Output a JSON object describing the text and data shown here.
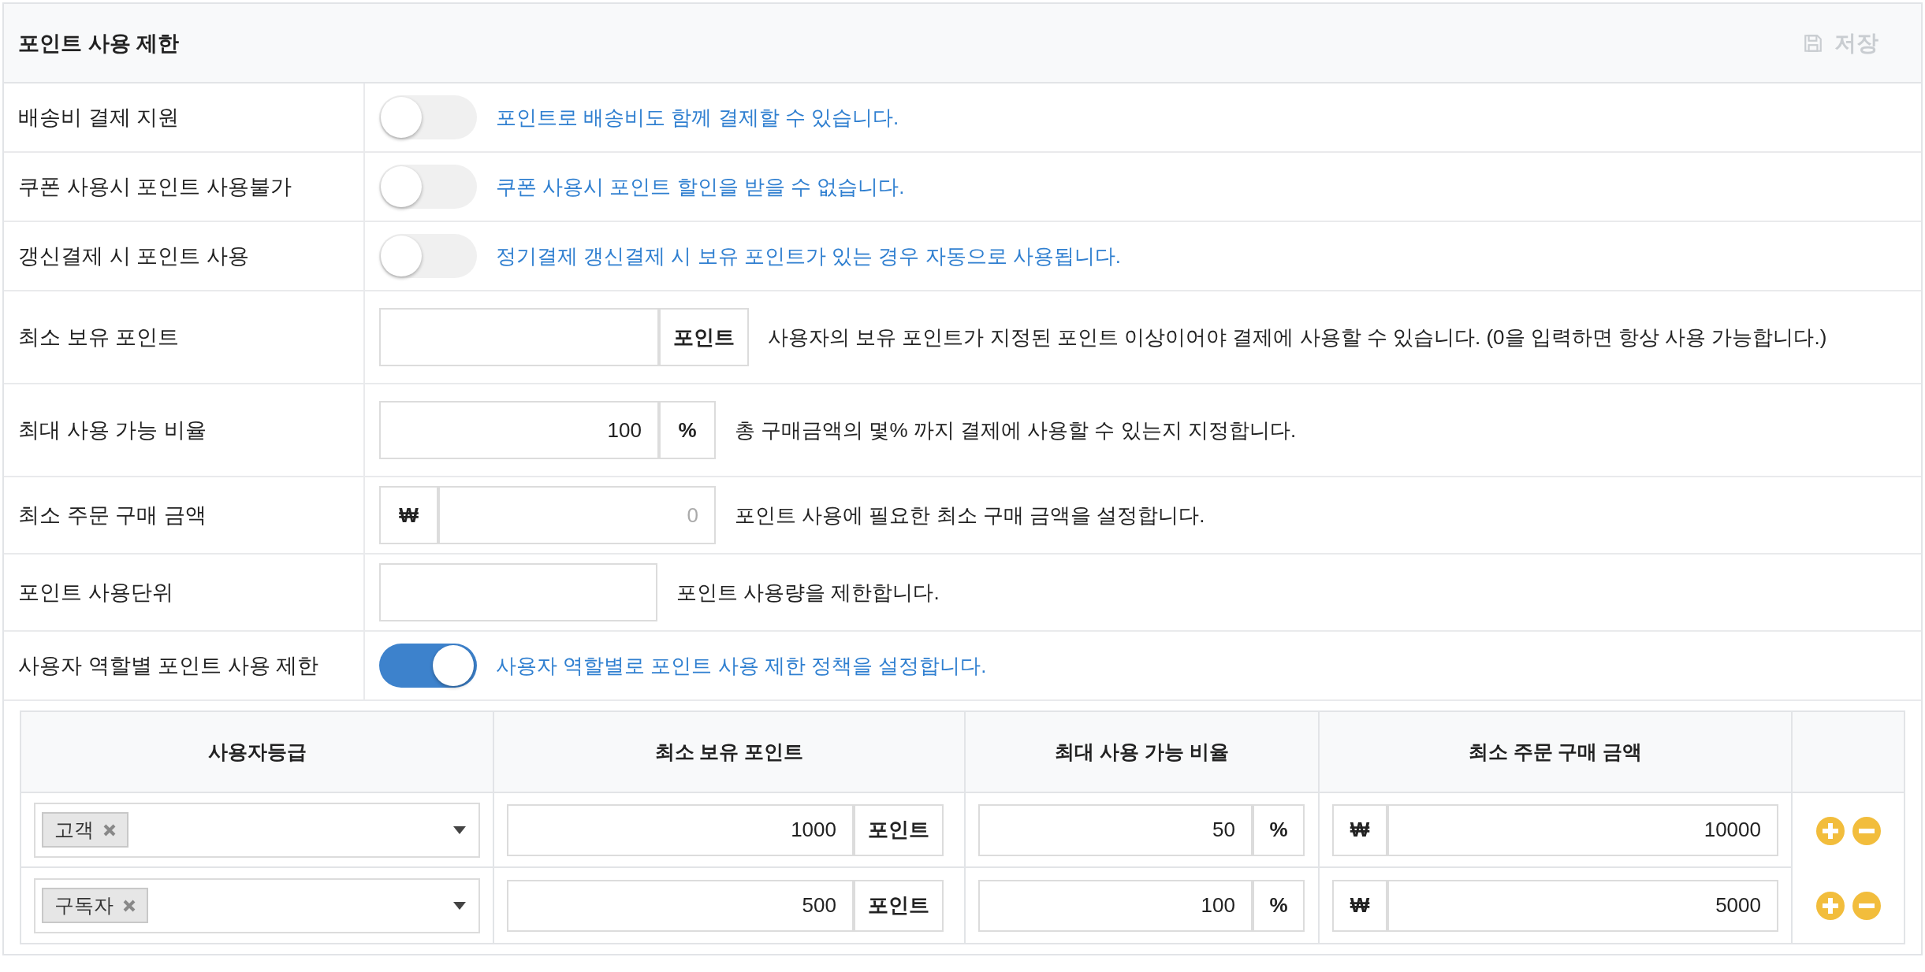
{
  "panel": {
    "title": "포인트 사용 제한",
    "save_button": {
      "label": "저장",
      "disabled": true
    }
  },
  "settings": [
    {
      "kind": "toggle",
      "label": "배송비 결제 지원",
      "on": false,
      "help": "포인트로 배송비도 함께 결제할 수 있습니다."
    },
    {
      "kind": "toggle",
      "label": "쿠폰 사용시 포인트 사용불가",
      "on": false,
      "help": "쿠폰 사용시 포인트 할인을 받을 수 없습니다."
    },
    {
      "kind": "toggle",
      "label": "갱신결제 시 포인트 사용",
      "on": false,
      "help": "정기결제 갱신결제 시 보유 포인트가 있는 경우 자동으로 사용됩니다."
    },
    {
      "kind": "suffix",
      "label": "최소 보유 포인트",
      "unit": "포인트",
      "help": "사용자의 보유 포인트가 지정된 포인트 이상이어야 결제에 사용할 수 있습니다. (0을 입력하면 항상 사용 가능합니다.)"
    },
    {
      "kind": "suffix",
      "label": "최대 사용 가능 비율",
      "value": "100",
      "unit": "%",
      "help": "총 구매금액의 몇% 까지 결제에 사용할 수 있는지 지정합니다."
    },
    {
      "kind": "prefix",
      "label": "최소 주문 구매 금액",
      "unit": "₩",
      "placeholder": "0",
      "help": "포인트 사용에 필요한 최소 구매 금액을 설정합니다."
    },
    {
      "kind": "plain",
      "label": "포인트 사용단위",
      "help": "포인트 사용량을 제한합니다."
    },
    {
      "kind": "toggle",
      "label": "사용자 역할별 포인트 사용 제한",
      "on": true,
      "help": "사용자 역할별로 포인트 사용 제한 정책을 설정합니다."
    }
  ],
  "role_table": {
    "columns": [
      "사용자등급",
      "최소 보유 포인트",
      "최대 사용 가능 비율",
      "최소 주문 구매 금액"
    ],
    "rows": [
      {
        "roles": [
          "고객"
        ],
        "min_points": {
          "value": "1000",
          "unit": "포인트"
        },
        "max_ratio": {
          "value": "50",
          "unit": "%"
        },
        "min_amount": {
          "unit": "₩",
          "value": "10000"
        }
      },
      {
        "roles": [
          "구독자"
        ],
        "min_points": {
          "value": "500",
          "unit": "포인트"
        },
        "max_ratio": {
          "value": "100",
          "unit": "%"
        },
        "min_amount": {
          "unit": "₩",
          "value": "5000"
        }
      }
    ]
  }
}
